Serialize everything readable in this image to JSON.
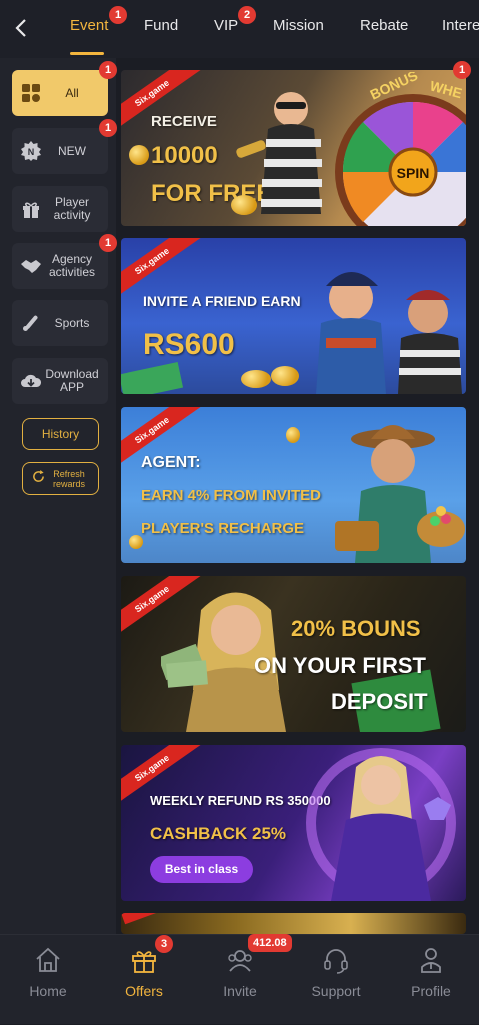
{
  "header": {
    "back_icon": "chevron-left-icon",
    "tabs": [
      {
        "label": "Event",
        "badge": "1",
        "active": true
      },
      {
        "label": "Fund"
      },
      {
        "label": "VIP",
        "badge": "2"
      },
      {
        "label": "Mission"
      },
      {
        "label": "Rebate"
      },
      {
        "label": "Intere"
      }
    ]
  },
  "sidebar": {
    "items": [
      {
        "label": "All",
        "badge": "1",
        "icon": "grid-icon",
        "active": true
      },
      {
        "label": "NEW",
        "badge": "1",
        "icon": "new-icon"
      },
      {
        "label": "Player activity",
        "icon": "gift-icon"
      },
      {
        "label": "Agency activities",
        "badge": "1",
        "icon": "handshake-icon"
      },
      {
        "label": "Sports",
        "icon": "sports-icon"
      },
      {
        "label": "Download APP",
        "icon": "download-cloud-icon"
      }
    ],
    "history_label": "History",
    "refresh_label": "Refresh rewards"
  },
  "banners": [
    {
      "brand": "Six.game",
      "line1": "RECEIVE",
      "line2": "10000",
      "line3": "FOR FREE",
      "wheel_bonus": "BONUS",
      "wheel_whe": "WHE",
      "wheel_spin": "SPIN",
      "badge": "1"
    },
    {
      "brand": "Six.game",
      "line1": "INVITE A FRIEND EARN",
      "line2": "RS600"
    },
    {
      "brand": "Six.game",
      "line1": "AGENT:",
      "line2": "EARN 4% FROM INVITED",
      "line3": "PLAYER'S RECHARGE"
    },
    {
      "brand": "Six.game",
      "line1": "20% BOUNS",
      "line2": "ON YOUR FIRST",
      "line3": "DEPOSIT"
    },
    {
      "brand": "Six.game",
      "line1": "WEEKLY REFUND RS 350000",
      "line2": "CASHBACK 25%",
      "button": "Best in class"
    }
  ],
  "bottom_nav": [
    {
      "label": "Home",
      "icon": "home-icon"
    },
    {
      "label": "Offers",
      "icon": "gift-box-icon",
      "badge": "3",
      "active": true
    },
    {
      "label": "Invite",
      "icon": "invite-people-icon",
      "badge": "412.08"
    },
    {
      "label": "Support",
      "icon": "headset-icon"
    },
    {
      "label": "Profile",
      "icon": "person-icon"
    }
  ],
  "colors": {
    "accent": "#f3b53e",
    "badge": "#e23a32",
    "background": "#1b1d24"
  }
}
